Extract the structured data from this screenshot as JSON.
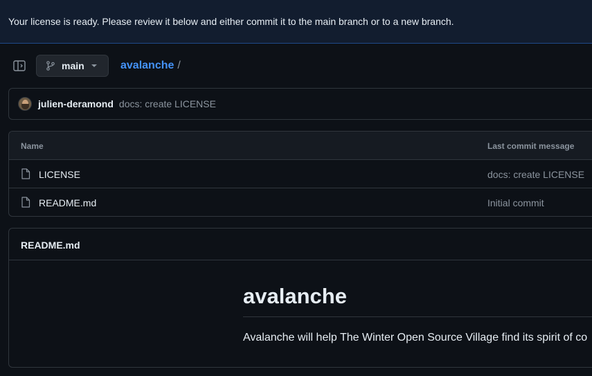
{
  "flash": {
    "message": "Your license is ready. Please review it below and either commit it to the main branch or to a new branch."
  },
  "toolbar": {
    "sidebar_toggle_icon": "sidebar-toggle-icon",
    "branch": {
      "label": "main",
      "icon": "git-branch-icon"
    },
    "breadcrumb": {
      "repo": "avalanche",
      "separator": "/"
    }
  },
  "commit": {
    "author": "julien-deramond",
    "message": "docs: create LICENSE"
  },
  "files": {
    "columns": {
      "name": "Name",
      "last_commit": "Last commit message"
    },
    "rows": [
      {
        "name": "LICENSE",
        "commit_message": "docs: create LICENSE",
        "icon": "file-icon"
      },
      {
        "name": "README.md",
        "commit_message": "Initial commit",
        "icon": "file-icon"
      }
    ]
  },
  "readme": {
    "title": "README.md",
    "heading": "avalanche",
    "paragraph": "Avalanche will help The Winter Open Source Village find its spirit of co"
  },
  "colors": {
    "accent": "#4493f8",
    "background": "#0d1117",
    "border": "#30363d",
    "flash_bg": "#121d2f"
  }
}
